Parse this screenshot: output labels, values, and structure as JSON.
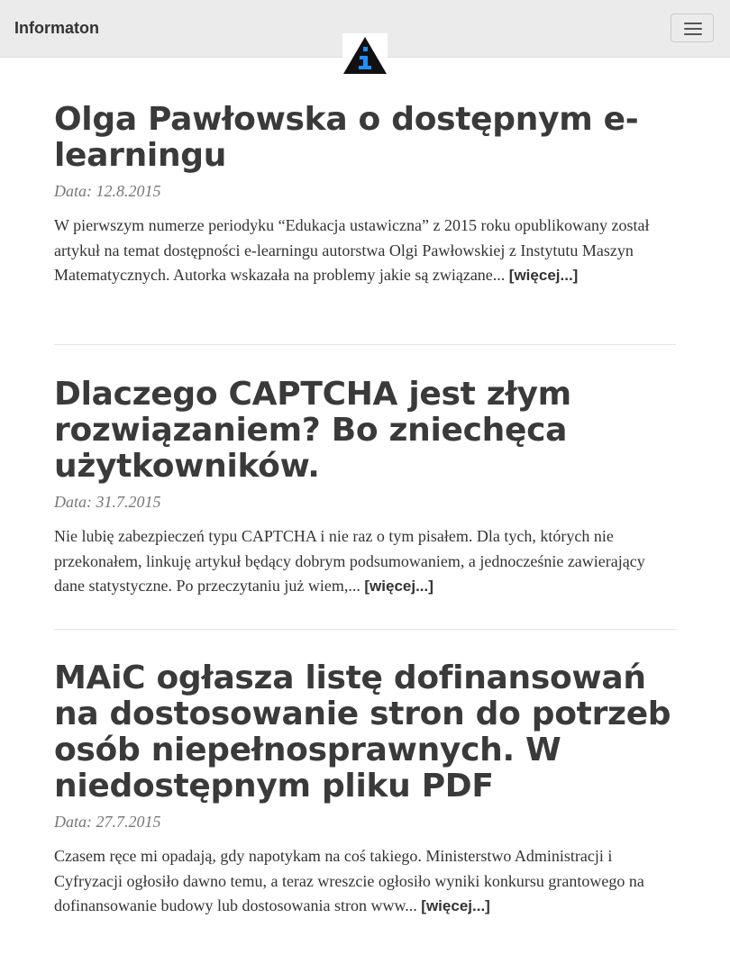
{
  "navbar": {
    "brand": "Informaton",
    "toggle_icon": "hamburger-menu-icon",
    "logo_icon": "info-triangle-logo-icon",
    "colors": {
      "background": "#ebebeb",
      "logo_triangle": "#111111",
      "logo_letter": "#1e90ff"
    }
  },
  "posts": [
    {
      "title": "Olga Pawłowska o dostępnym e-learningu",
      "date": "Data: 12.8.2015",
      "excerpt": "W pierwszym numerze periodyku “Edukacja ustawiczna” z 2015 roku opublikowany został artykuł na temat dostępności e-learningu autorstwa Olgi Pawłowskiej z Instytutu Maszyn Matematycznych. Autorka wskazała na problemy jakie są związane...",
      "more": "[więcej...]"
    },
    {
      "title": "Dlaczego CAPTCHA jest złym rozwiązaniem? Bo zniechęca użytkowników.",
      "date": "Data: 31.7.2015",
      "excerpt": "Nie lubię zabezpieczeń typu CAPTCHA i nie raz o tym pisałem. Dla tych, których nie przekonałem, linkuję artykuł będący dobrym podsumowaniem, a jednocześnie zawierający dane statystyczne. Po przeczytaniu już wiem,...",
      "more": "[więcej...]"
    },
    {
      "title": "MAiC ogłasza listę dofinansowań na dostosowanie stron do potrzeb osób niepełnosprawnych. W niedostępnym pliku PDF",
      "date": "Data: 27.7.2015",
      "excerpt": "Czasem ręce mi opadają, gdy napotykam na coś takiego. Ministerstwo Administracji i Cyfryzacji ogłosiło dawno temu, a teraz wreszcie ogłosiło wyniki konkursu grantowego na dofinansowanie budowy lub dostosowania stron www...",
      "more": "[więcej...]"
    }
  ]
}
